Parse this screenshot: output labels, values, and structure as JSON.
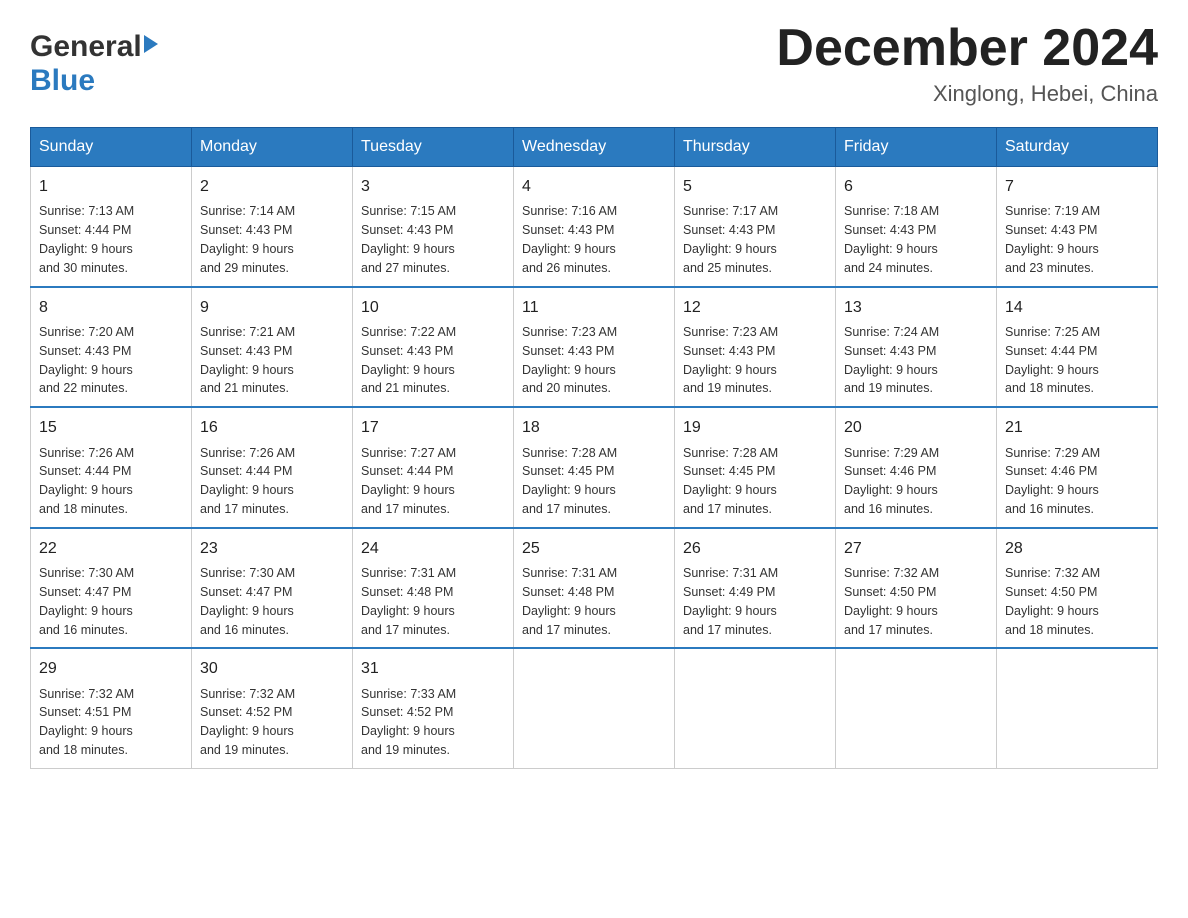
{
  "logo": {
    "general": "General",
    "blue": "Blue"
  },
  "header": {
    "month": "December 2024",
    "location": "Xinglong, Hebei, China"
  },
  "weekdays": [
    "Sunday",
    "Monday",
    "Tuesday",
    "Wednesday",
    "Thursday",
    "Friday",
    "Saturday"
  ],
  "weeks": [
    [
      {
        "day": "1",
        "sunrise": "7:13 AM",
        "sunset": "4:44 PM",
        "daylight": "9 hours and 30 minutes."
      },
      {
        "day": "2",
        "sunrise": "7:14 AM",
        "sunset": "4:43 PM",
        "daylight": "9 hours and 29 minutes."
      },
      {
        "day": "3",
        "sunrise": "7:15 AM",
        "sunset": "4:43 PM",
        "daylight": "9 hours and 27 minutes."
      },
      {
        "day": "4",
        "sunrise": "7:16 AM",
        "sunset": "4:43 PM",
        "daylight": "9 hours and 26 minutes."
      },
      {
        "day": "5",
        "sunrise": "7:17 AM",
        "sunset": "4:43 PM",
        "daylight": "9 hours and 25 minutes."
      },
      {
        "day": "6",
        "sunrise": "7:18 AM",
        "sunset": "4:43 PM",
        "daylight": "9 hours and 24 minutes."
      },
      {
        "day": "7",
        "sunrise": "7:19 AM",
        "sunset": "4:43 PM",
        "daylight": "9 hours and 23 minutes."
      }
    ],
    [
      {
        "day": "8",
        "sunrise": "7:20 AM",
        "sunset": "4:43 PM",
        "daylight": "9 hours and 22 minutes."
      },
      {
        "day": "9",
        "sunrise": "7:21 AM",
        "sunset": "4:43 PM",
        "daylight": "9 hours and 21 minutes."
      },
      {
        "day": "10",
        "sunrise": "7:22 AM",
        "sunset": "4:43 PM",
        "daylight": "9 hours and 21 minutes."
      },
      {
        "day": "11",
        "sunrise": "7:23 AM",
        "sunset": "4:43 PM",
        "daylight": "9 hours and 20 minutes."
      },
      {
        "day": "12",
        "sunrise": "7:23 AM",
        "sunset": "4:43 PM",
        "daylight": "9 hours and 19 minutes."
      },
      {
        "day": "13",
        "sunrise": "7:24 AM",
        "sunset": "4:43 PM",
        "daylight": "9 hours and 19 minutes."
      },
      {
        "day": "14",
        "sunrise": "7:25 AM",
        "sunset": "4:44 PM",
        "daylight": "9 hours and 18 minutes."
      }
    ],
    [
      {
        "day": "15",
        "sunrise": "7:26 AM",
        "sunset": "4:44 PM",
        "daylight": "9 hours and 18 minutes."
      },
      {
        "day": "16",
        "sunrise": "7:26 AM",
        "sunset": "4:44 PM",
        "daylight": "9 hours and 17 minutes."
      },
      {
        "day": "17",
        "sunrise": "7:27 AM",
        "sunset": "4:44 PM",
        "daylight": "9 hours and 17 minutes."
      },
      {
        "day": "18",
        "sunrise": "7:28 AM",
        "sunset": "4:45 PM",
        "daylight": "9 hours and 17 minutes."
      },
      {
        "day": "19",
        "sunrise": "7:28 AM",
        "sunset": "4:45 PM",
        "daylight": "9 hours and 17 minutes."
      },
      {
        "day": "20",
        "sunrise": "7:29 AM",
        "sunset": "4:46 PM",
        "daylight": "9 hours and 16 minutes."
      },
      {
        "day": "21",
        "sunrise": "7:29 AM",
        "sunset": "4:46 PM",
        "daylight": "9 hours and 16 minutes."
      }
    ],
    [
      {
        "day": "22",
        "sunrise": "7:30 AM",
        "sunset": "4:47 PM",
        "daylight": "9 hours and 16 minutes."
      },
      {
        "day": "23",
        "sunrise": "7:30 AM",
        "sunset": "4:47 PM",
        "daylight": "9 hours and 16 minutes."
      },
      {
        "day": "24",
        "sunrise": "7:31 AM",
        "sunset": "4:48 PM",
        "daylight": "9 hours and 17 minutes."
      },
      {
        "day": "25",
        "sunrise": "7:31 AM",
        "sunset": "4:48 PM",
        "daylight": "9 hours and 17 minutes."
      },
      {
        "day": "26",
        "sunrise": "7:31 AM",
        "sunset": "4:49 PM",
        "daylight": "9 hours and 17 minutes."
      },
      {
        "day": "27",
        "sunrise": "7:32 AM",
        "sunset": "4:50 PM",
        "daylight": "9 hours and 17 minutes."
      },
      {
        "day": "28",
        "sunrise": "7:32 AM",
        "sunset": "4:50 PM",
        "daylight": "9 hours and 18 minutes."
      }
    ],
    [
      {
        "day": "29",
        "sunrise": "7:32 AM",
        "sunset": "4:51 PM",
        "daylight": "9 hours and 18 minutes."
      },
      {
        "day": "30",
        "sunrise": "7:32 AM",
        "sunset": "4:52 PM",
        "daylight": "9 hours and 19 minutes."
      },
      {
        "day": "31",
        "sunrise": "7:33 AM",
        "sunset": "4:52 PM",
        "daylight": "9 hours and 19 minutes."
      },
      null,
      null,
      null,
      null
    ]
  ],
  "labels": {
    "sunrise": "Sunrise:",
    "sunset": "Sunset:",
    "daylight": "Daylight: 9 hours"
  },
  "colors": {
    "header_bg": "#2b7abf",
    "header_text": "#ffffff",
    "border": "#2b7abf"
  }
}
